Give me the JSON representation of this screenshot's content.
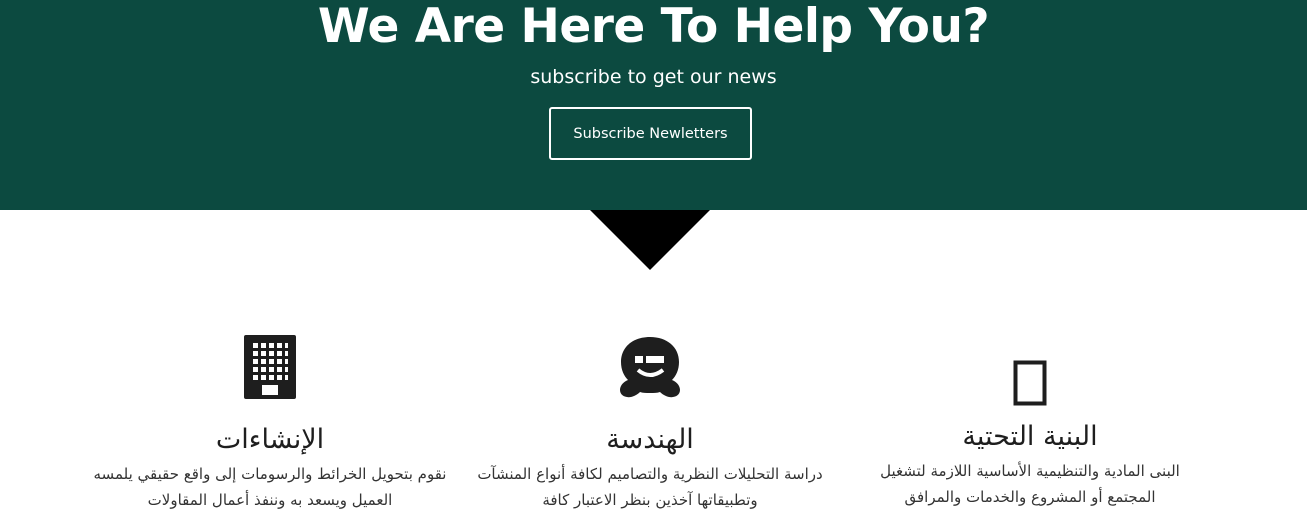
{
  "hero": {
    "title": "We Are Here To Help You?",
    "subtitle": "subscribe to get our news",
    "button_label": "Subscribe Newletters",
    "background_color": "#0c4a40"
  },
  "features": [
    {
      "icon": "building-icon",
      "title": "الإنشاءات",
      "text": "نقوم بتحويل الخرائط والرسومات إلى واقع حقيقي يلمسه العميل ويسعد به وننفذ أعمال المقاولات"
    },
    {
      "icon": "wpbeginner-icon",
      "title": "الهندسة",
      "text": "دراسة التحليلات النظرية والتصاميم لكافة أنواع المنشآت وتطبيقاتها آخذين بنظر الاعتبار كافة"
    },
    {
      "icon": "placeholder-box-icon",
      "title": "البنية التحتية",
      "text": "البنى المادية والتنظيمية الأساسية اللازمة لتشغيل المجتمع أو المشروع والخدمات والمرافق"
    }
  ]
}
